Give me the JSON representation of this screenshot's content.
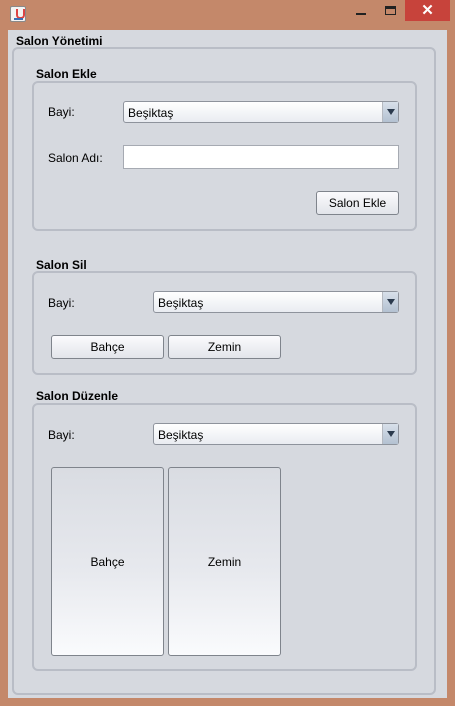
{
  "window": {
    "controls": {
      "close": "✕"
    }
  },
  "main": {
    "title": "Salon Yönetimi",
    "salon_ekle": {
      "title": "Salon Ekle",
      "bayi_label": "Bayi:",
      "bayi_value": "Beşiktaş",
      "salon_adi_label": "Salon Adı:",
      "salon_adi_value": "",
      "add_button": "Salon Ekle"
    },
    "salon_sil": {
      "title": "Salon Sil",
      "bayi_label": "Bayi:",
      "bayi_value": "Beşiktaş",
      "buttons": [
        "Bahçe",
        "Zemin"
      ]
    },
    "salon_duzenle": {
      "title": "Salon Düzenle",
      "bayi_label": "Bayi:",
      "bayi_value": "Beşiktaş",
      "buttons": [
        "Bahçe",
        "Zemin"
      ]
    }
  }
}
